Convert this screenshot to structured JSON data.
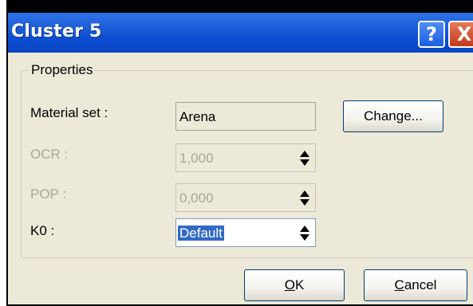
{
  "window": {
    "title": "Cluster 5",
    "help_glyph": "?",
    "close_glyph": "X"
  },
  "properties": {
    "group_label": "Properties",
    "material_set": {
      "label": "Material set :",
      "value": "Arena",
      "change_button": "Change..."
    },
    "ocr": {
      "label": "OCR :",
      "value": "1,000"
    },
    "pop": {
      "label": "POP :",
      "value": "0,000"
    },
    "k0": {
      "label": "K0 :",
      "value": "Default"
    }
  },
  "buttons": {
    "ok_mnemonic": "O",
    "ok_rest": "K",
    "cancel_mnemonic": "C",
    "cancel_rest": "ancel"
  }
}
